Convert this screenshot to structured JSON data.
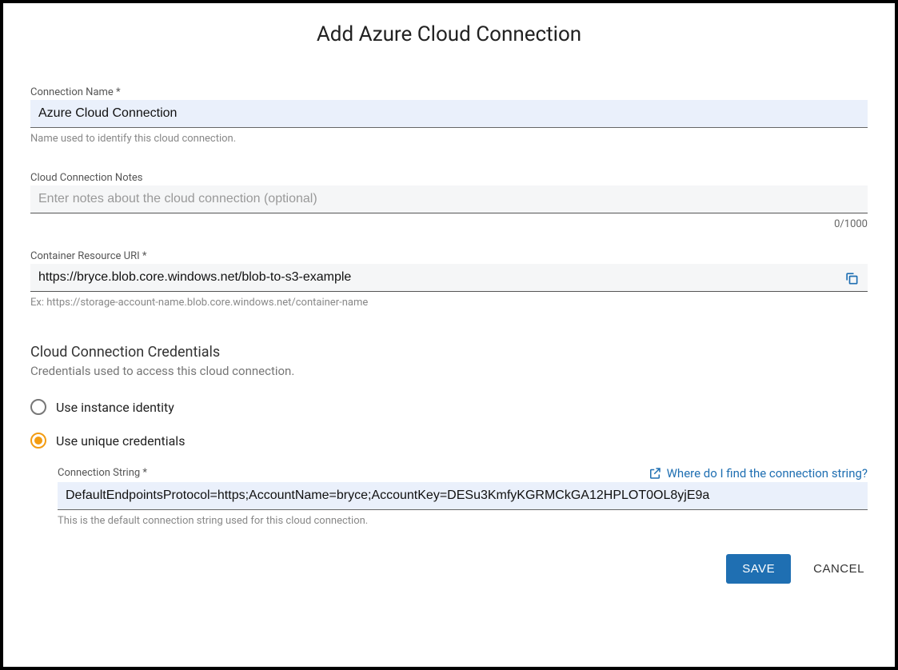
{
  "dialog": {
    "title": "Add Azure Cloud Connection"
  },
  "connection_name": {
    "label": "Connection Name *",
    "value": "Azure Cloud Connection",
    "help": "Name used to identify this cloud connection."
  },
  "notes": {
    "label": "Cloud Connection Notes",
    "placeholder": "Enter notes about the cloud connection (optional)",
    "value": "",
    "counter": "0/1000"
  },
  "container_uri": {
    "label": "Container Resource URI *",
    "value": "https://bryce.blob.core.windows.net/blob-to-s3-example",
    "help": "Ex: https://storage-account-name.blob.core.windows.net/container-name"
  },
  "credentials": {
    "heading": "Cloud Connection Credentials",
    "subheading": "Credentials used to access this cloud connection.",
    "options": {
      "instance": "Use instance identity",
      "unique": "Use unique credentials"
    },
    "selected": "unique"
  },
  "connection_string": {
    "label": "Connection String *",
    "value": "DefaultEndpointsProtocol=https;AccountName=bryce;AccountKey=DESu3KmfyKGRMCkGA12HPLOT0OL8yjE9a",
    "help": "This is the default connection string used for this cloud connection.",
    "help_link": "Where do I find the connection string?"
  },
  "buttons": {
    "save": "SAVE",
    "cancel": "CANCEL"
  },
  "icons": {
    "copy": "copy-icon",
    "external": "external-link-icon"
  }
}
